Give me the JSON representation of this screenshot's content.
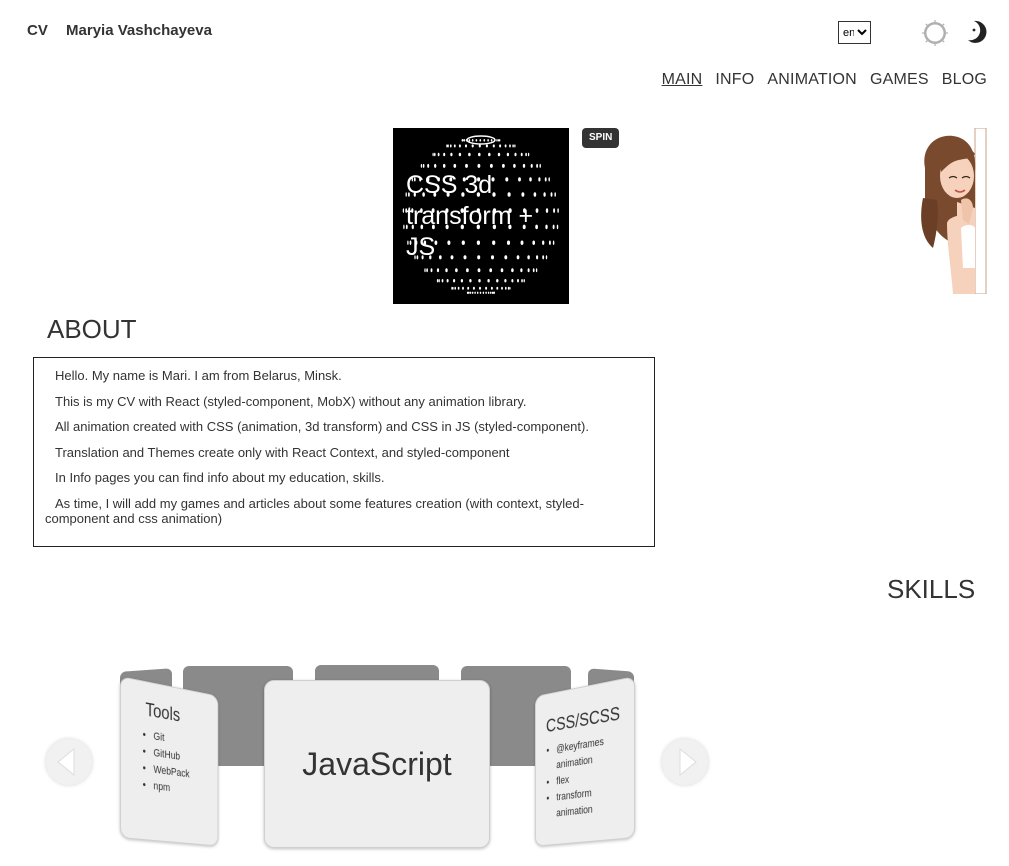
{
  "header": {
    "brand_short": "CV",
    "brand_name": "Maryia Vashchayeva",
    "language": {
      "selected": "en",
      "options": [
        "en"
      ]
    },
    "theme_icons": [
      "sun-icon",
      "moon-icon"
    ]
  },
  "nav": {
    "items": [
      {
        "label": "MAIN",
        "active": true
      },
      {
        "label": "INFO",
        "active": false
      },
      {
        "label": "ANIMATION",
        "active": false
      },
      {
        "label": "GAMES",
        "active": false
      },
      {
        "label": "BLOG",
        "active": false
      }
    ]
  },
  "hero": {
    "sphere_text": "CSS 3d transform + JS",
    "spin_label": "SPIN"
  },
  "about": {
    "title": "ABOUT",
    "paragraphs": [
      "Hello. My name is Mari. I am from Belarus, Minsk.",
      "This is my CV with React (styled-component, MobX) without any animation library.",
      "All animation created with CSS (animation, 3d transform) and CSS in JS (styled-component).",
      "Translation and Themes create only with React Context, and styled-component",
      "In Info pages you can find info about my education, skills.",
      "As time, I will add my games and articles about some features creation (with context, styled-component and css animation)"
    ]
  },
  "skills": {
    "title": "SKILLS",
    "cards": {
      "left": {
        "title": "Tools",
        "items": [
          "Git",
          "GitHub",
          "WebPack",
          "npm"
        ]
      },
      "center": {
        "title": "JavaScript"
      },
      "right": {
        "title": "CSS/SCSS",
        "items": [
          "@keyframes animation",
          "flex",
          "transform animation"
        ]
      }
    }
  },
  "colors": {
    "text": "#333333",
    "sphere_bg": "#000000",
    "badge_bg": "#333333",
    "card_back": "#8a8a8a",
    "card_face": "#eeeeee"
  }
}
